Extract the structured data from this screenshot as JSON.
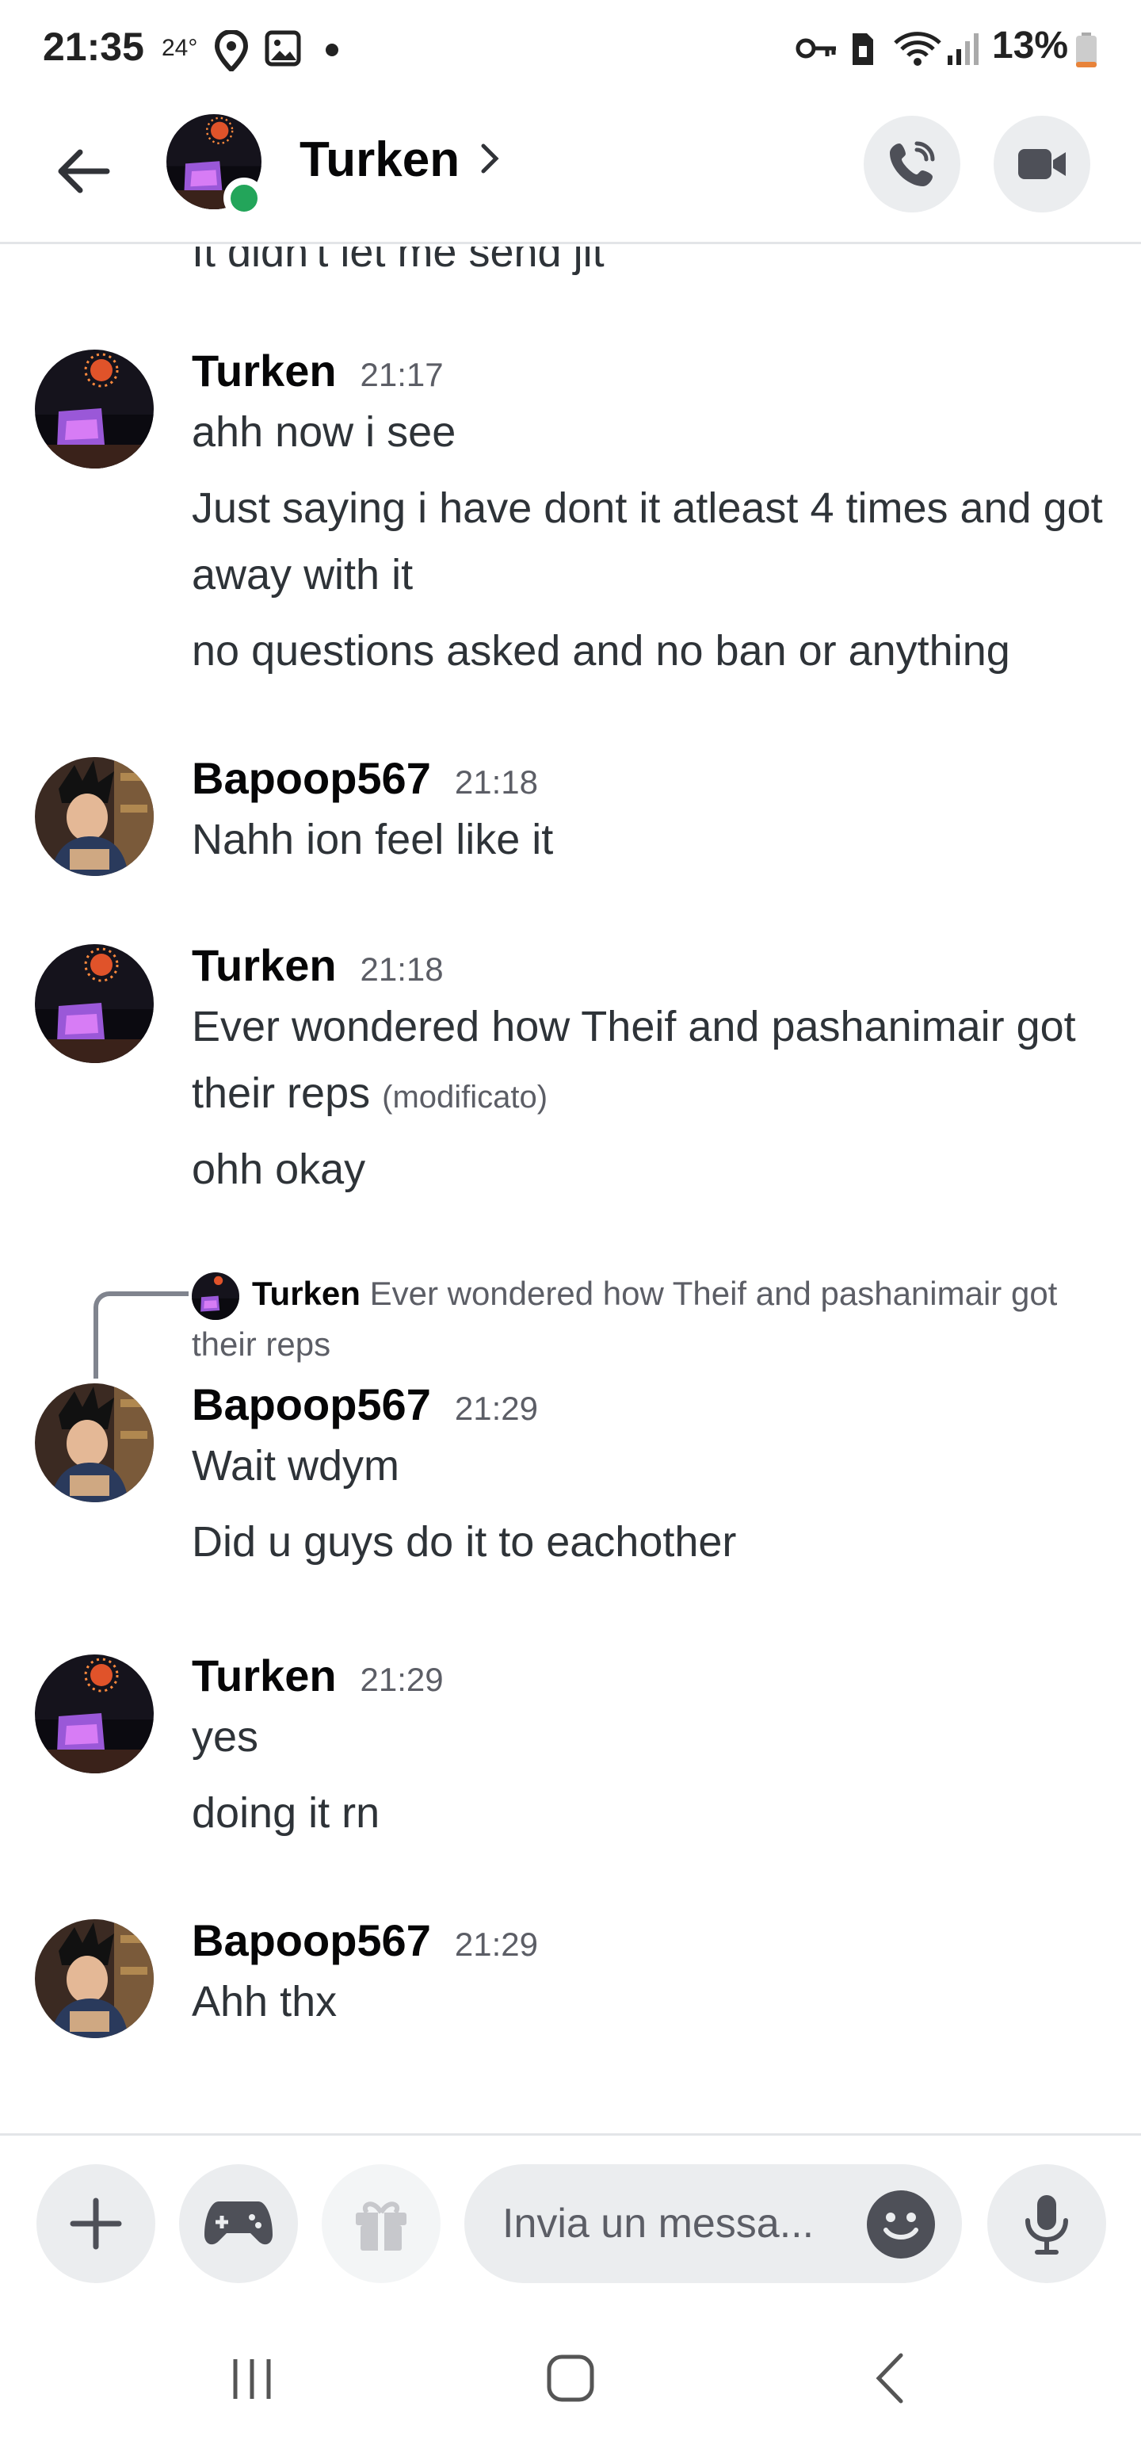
{
  "status_bar": {
    "time": "21:35",
    "temperature": "24°",
    "battery": "13%"
  },
  "header": {
    "title": "Turken",
    "online_color": "#23a55a"
  },
  "messages": {
    "partial_text": "It didn't let me send jit",
    "groups": [
      {
        "author": "Turken",
        "time": "21:17",
        "lines": [
          "ahh now i see",
          "Just saying i have dont it atleast 4 times and got away with it",
          "no questions asked and no ban or anything"
        ]
      },
      {
        "author": "Bapoop567",
        "time": "21:18",
        "lines": [
          "Nahh ion feel like it"
        ]
      },
      {
        "author": "Turken",
        "time": "21:18",
        "lines": [
          "Ever wondered how Theif and pashanimair got their reps",
          "ohh okay"
        ],
        "edited": "(modificato)"
      },
      {
        "author": "Bapoop567",
        "time": "21:29",
        "lines": [
          "Wait wdym",
          "Did u guys do it to eachother"
        ],
        "reply": {
          "author": "Turken",
          "text": "Ever wondered how Theif and pashanimair got their reps"
        }
      },
      {
        "author": "Turken",
        "time": "21:29",
        "lines": [
          "yes",
          "doing it rn"
        ]
      },
      {
        "author": "Bapoop567",
        "time": "21:29",
        "lines": [
          "Ahh thx"
        ]
      }
    ]
  },
  "composer": {
    "placeholder": "Invia un messa..."
  },
  "icons": {
    "back": "arrow-left-icon",
    "call": "phone-icon",
    "video": "video-camera-icon",
    "add": "plus-icon",
    "games": "gamepad-icon",
    "gift": "gift-icon",
    "emoji": "emoji-icon",
    "mic": "microphone-icon"
  }
}
